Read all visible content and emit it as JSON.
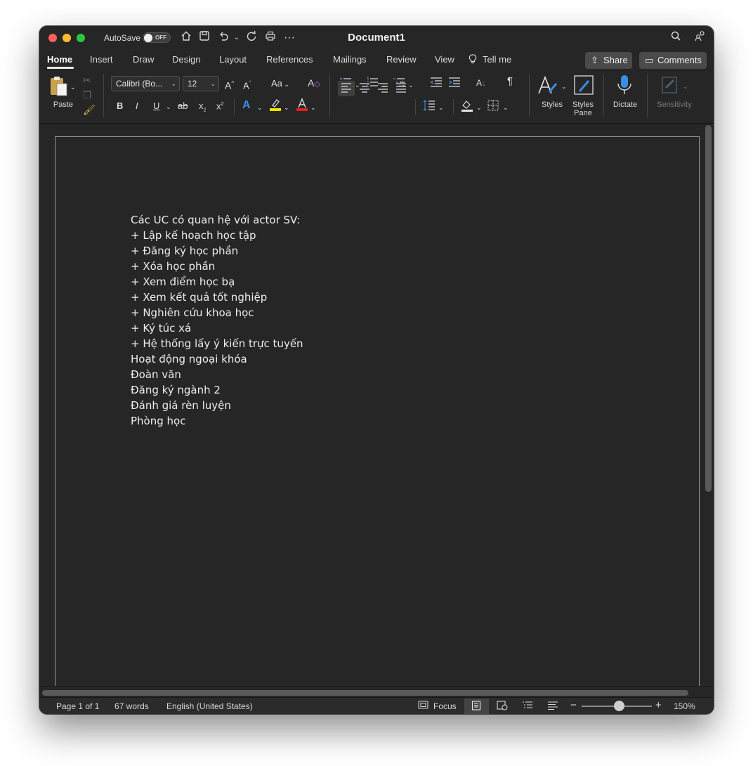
{
  "titlebar": {
    "autosave_label": "AutoSave",
    "autosave_state": "OFF",
    "document_title": "Document1"
  },
  "tabs": [
    "Home",
    "Insert",
    "Draw",
    "Design",
    "Layout",
    "References",
    "Mailings",
    "Review",
    "View",
    "Tell me"
  ],
  "active_tab": "Home",
  "share_label": "Share",
  "comments_label": "Comments",
  "ribbon": {
    "paste_label": "Paste",
    "font_name": "Calibri (Bo...",
    "font_size": "12",
    "bold": "B",
    "italic": "I",
    "underline": "U",
    "strike": "ab",
    "subscript": "x",
    "superscript": "x",
    "change_case": "Aa",
    "styles_label": "Styles",
    "styles_pane_label_1": "Styles",
    "styles_pane_label_2": "Pane",
    "dictate_label": "Dictate",
    "sensitivity_label": "Sensitivity",
    "colors": {
      "highlight": "#f5e400",
      "font_color": "#e02020",
      "accent_blue": "#3a8ee6"
    }
  },
  "document": {
    "lines": [
      "Các UC có quan hệ với actor SV:",
      "+ Lập kế hoạch học tập",
      "+ Đăng ký học phần",
      "+ Xóa học phần",
      "+ Xem điểm học bạ",
      "+ Xem kết quả tốt nghiệp",
      "+ Nghiên cứu khoa học",
      "+ Ký túc xá",
      "+ Hệ thống lấy ý kiến trực tuyến",
      "Hoạt động ngoại khóa",
      "Đoàn văn",
      "Đăng ký ngành 2",
      "Đánh giá rèn luyện",
      "Phòng học"
    ]
  },
  "status": {
    "page": "Page 1 of 1",
    "words": "67 words",
    "language": "English (United States)",
    "focus_label": "Focus",
    "zoom": "150%"
  }
}
